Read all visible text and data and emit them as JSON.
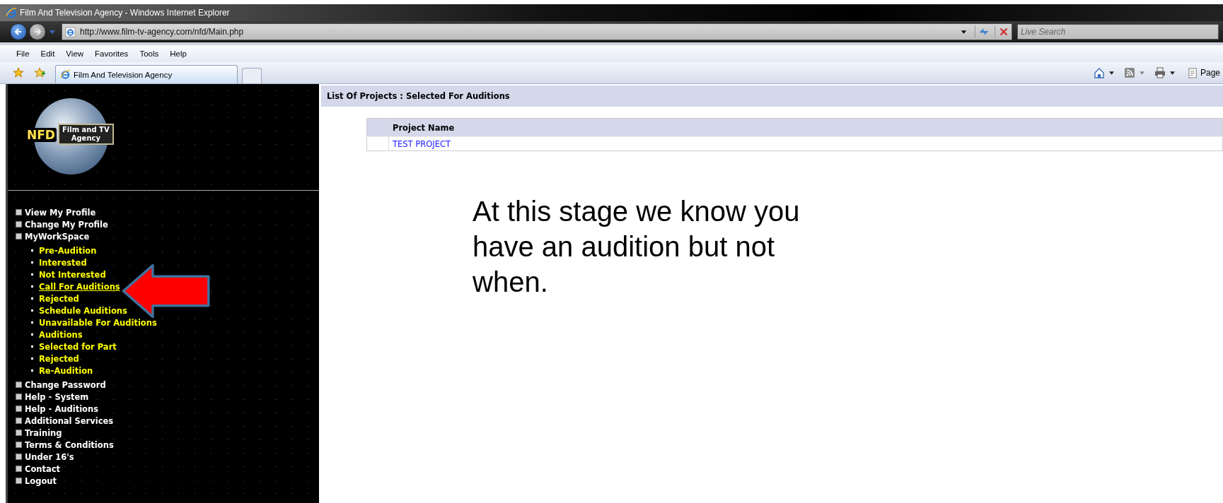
{
  "window": {
    "title": "Film And Television Agency - Windows Internet Explorer"
  },
  "address_bar": {
    "url": "http://www.film-tv-agency.com/nfd/Main.php"
  },
  "search": {
    "placeholder": "Live Search"
  },
  "menu_bar": [
    "File",
    "Edit",
    "View",
    "Favorites",
    "Tools",
    "Help"
  ],
  "tabs": [
    {
      "label": "Film And Television Agency",
      "selected": true
    }
  ],
  "command_bar": {
    "page_label": "Page"
  },
  "logo": {
    "mark": "NFD",
    "text_line_1": "Film and TV",
    "text_line_2": "Agency"
  },
  "sidebar": {
    "items": [
      {
        "label": "View My Profile"
      },
      {
        "label": "Change My Profile"
      },
      {
        "label": "MyWorkSpace",
        "children": [
          {
            "label": "Pre-Audition",
            "selected": false
          },
          {
            "label": "Interested",
            "selected": false
          },
          {
            "label": "Not Interested",
            "selected": false
          },
          {
            "label": "Call For Auditions",
            "selected": true
          },
          {
            "label": "Rejected",
            "selected": false
          },
          {
            "label": "Schedule Auditions",
            "selected": false
          },
          {
            "label": "Unavailable For Auditions",
            "selected": false
          },
          {
            "label": "Auditions",
            "selected": false
          },
          {
            "label": "Selected for Part",
            "selected": false
          },
          {
            "label": "Rejected",
            "selected": false
          },
          {
            "label": "Re-Audition",
            "selected": false
          }
        ]
      },
      {
        "label": "Change Password"
      },
      {
        "label": "Help - System"
      },
      {
        "label": "Help - Auditions"
      },
      {
        "label": "Additional Services"
      },
      {
        "label": "Training"
      },
      {
        "label": "Terms & Conditions"
      },
      {
        "label": "Under 16's"
      },
      {
        "label": "Contact"
      },
      {
        "label": "Logout"
      }
    ]
  },
  "content": {
    "heading": "List Of Projects : Selected For Auditions",
    "table": {
      "columns": [
        "Project Name"
      ],
      "rows": [
        [
          "TEST PROJECT"
        ]
      ]
    }
  },
  "annotation": {
    "text": "At this stage we know you have an audition but not when."
  }
}
